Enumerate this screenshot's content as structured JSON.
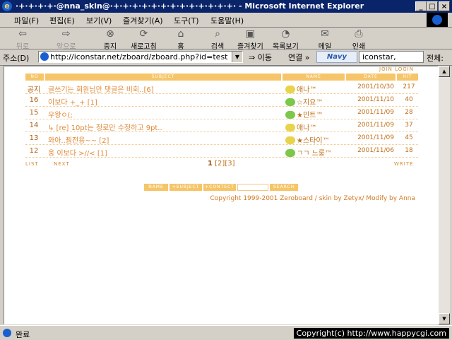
{
  "window": {
    "title": "·+·+·+·+·@nna_skin@·+·+·+·+·+·+·+·+·+·+·+·+·+· - Microsoft Internet Explorer",
    "min": "_",
    "max": "□",
    "close": "×"
  },
  "menu": [
    "파일(F)",
    "편집(E)",
    "보기(V)",
    "즐겨찾기(A)",
    "도구(T)",
    "도움말(H)"
  ],
  "toolbar": {
    "back": "뒤로",
    "forward": "앞으로",
    "stop": "중지",
    "refresh": "새로고침",
    "home": "홈",
    "search": "검색",
    "favorites": "즐겨찾기",
    "history": "목록보기",
    "mail": "메일",
    "print": "인쇄"
  },
  "address": {
    "label": "주소(D)",
    "url": "http://iconstar.net/zboard/zboard.php?id=test",
    "go": "이동",
    "links": "연결 »",
    "navy_logo": "Navy",
    "navy_search": "iconstar,",
    "navy_all": "전체:"
  },
  "board": {
    "join_login": "JOIN LOGIN",
    "headers": {
      "no": "NO",
      "subject": "SUBJECT",
      "name": "NAME",
      "date": "DATE",
      "hit": "HIT"
    },
    "rows": [
      {
        "no": "공지",
        "subject": "글쓰기는 회원님만 댓글은 비회..[6]",
        "name": "애나™",
        "date": "2001/10/30",
        "hit": "217"
      },
      {
        "no": "16",
        "subject": "이보다 +_+ [1]",
        "name": "☆지요™",
        "date": "2001/11/10",
        "hit": "40"
      },
      {
        "no": "15",
        "subject": "우왕ㅇ(;",
        "name": "★민트™",
        "date": "2001/11/09",
        "hit": "28"
      },
      {
        "no": "14",
        "subject": "↳ [re] 10pt는 정로만 수정하고 9pt..",
        "name": "애나™",
        "date": "2001/11/09",
        "hit": "37"
      },
      {
        "no": "13",
        "subject": "와아..꿤전용~~ [2]",
        "name": "★스타이™",
        "date": "2001/11/09",
        "hit": "45"
      },
      {
        "no": "12",
        "subject": "웅 이보다 >//< [1]",
        "name": "ㄱㄱ 느룽™",
        "date": "2001/11/06",
        "hit": "18"
      }
    ],
    "list_link": "LIST",
    "next_link": "NEXT",
    "write_link": "WRITE",
    "pager": {
      "current": "1",
      "page2": "[2]",
      "page3": "[3]"
    },
    "search": {
      "name": "NAME",
      "subject": "+SUBJECT",
      "contents": "+CONTECT",
      "button": "SEARCH"
    },
    "footer": "Copyright 1999-2001 Zeroboard / skin by  Zetyx/ Modify by Anna"
  },
  "status": {
    "text": "완료",
    "copyright": "Copyright(c) http://www.happycgi.com"
  }
}
